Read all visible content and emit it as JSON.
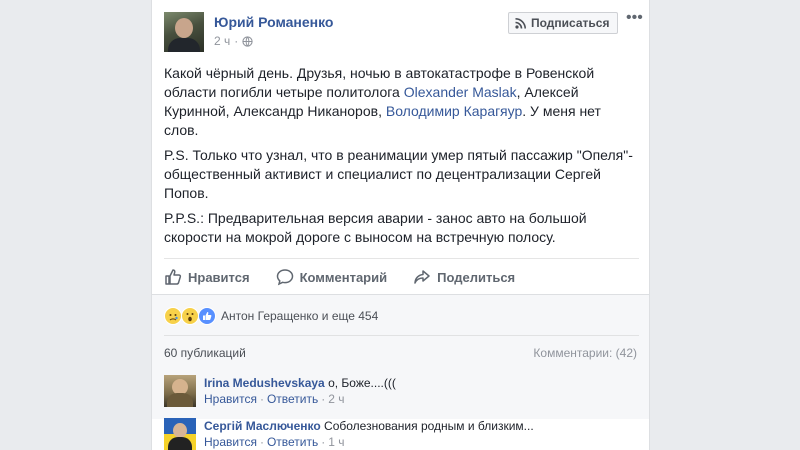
{
  "post": {
    "author": "Юрий Романенко",
    "time": "2 ч",
    "subscribe_label": "Подписаться",
    "more_label": "•••",
    "paragraphs": {
      "p1_a": "Какой чёрный день. Друзья, ночью в автокатастрофе в Ровенской области погибли четыре политолога ",
      "p1_link1": "Olexander Maslak",
      "p1_b": ", Алексей Куринной, Александр Никаноров, ",
      "p1_link2": "Володимир Карагяур",
      "p1_c": ". У меня нет слов.",
      "p2": "P.S. Только что узнал, что в реанимации умер пятый пассажир \"Опеля\"- общественный активист и специалист по децентрализации Сергей Попов.",
      "p3": "P.P.S.: Предварительная версия аварии - занос авто на большой скорости на мокрой дороге с выносом на встречную полосу."
    }
  },
  "actions": {
    "like": "Нравится",
    "comment": "Комментарий",
    "share": "Поделиться"
  },
  "reactions": {
    "icons": [
      "sad-reaction-icon",
      "wow-reaction-icon",
      "like-reaction-icon"
    ],
    "summary": "Антон Геращенко и еще 454"
  },
  "stats": {
    "shares": "60 публикаций",
    "comments": "Комментарии: (42)"
  },
  "comments": [
    {
      "author": "Irina Medushevskaya",
      "text": "о, Боже....(((",
      "like": "Нравится",
      "reply": "Ответить",
      "time": "2 ч"
    },
    {
      "author": "Сергій Маслюченко",
      "text": "Соболезнования родным и близким...",
      "like": "Нравится",
      "reply": "Ответить",
      "time": "1 ч"
    }
  ],
  "colors": {
    "link": "#365899",
    "background": "#e9ebee",
    "like_blue": "#5890ff"
  }
}
